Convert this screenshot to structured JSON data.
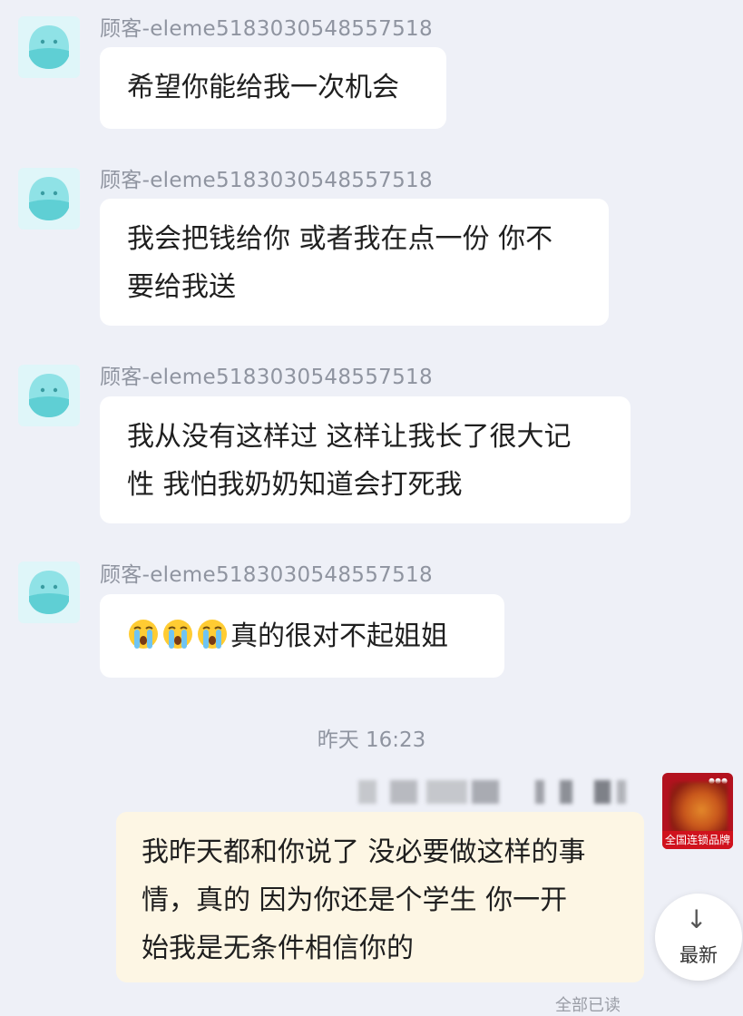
{
  "messages": [
    {
      "sender": "顾客-eleme5183030548557518",
      "lines": [
        "希望你能给我一次机会"
      ]
    },
    {
      "sender": "顾客-eleme5183030548557518",
      "lines": [
        "我会把钱给你 或者我在点一份 你不",
        "要给我送"
      ]
    },
    {
      "sender": "顾客-eleme5183030548557518",
      "lines": [
        "我从没有这样过 这样让我长了很大记",
        "性 我怕我奶奶知道会打死我"
      ]
    },
    {
      "sender": "顾客-eleme5183030548557518",
      "emoji": [
        "crying-face",
        "crying-face",
        "crying-face"
      ],
      "text": "真的很对不起姐姐"
    }
  ],
  "timestamp": "昨天 16:23",
  "store": {
    "badge": "全国连锁品牌"
  },
  "reply": {
    "lines": [
      "我昨天都和你说了 没必要做这样的事",
      "情，真的 因为你还是个学生 你一开",
      "始我是无条件相信你的"
    ]
  },
  "latest_button": {
    "icon": "arrow-down-icon",
    "label": "最新"
  },
  "bottom_partial": "全部已读",
  "colors": {
    "background": "#eef0f7",
    "bubble_in": "#ffffff",
    "bubble_out": "#fdf6e4",
    "avatar_bg": "#dff6f9",
    "avatar_face": "#8fe2e6"
  }
}
